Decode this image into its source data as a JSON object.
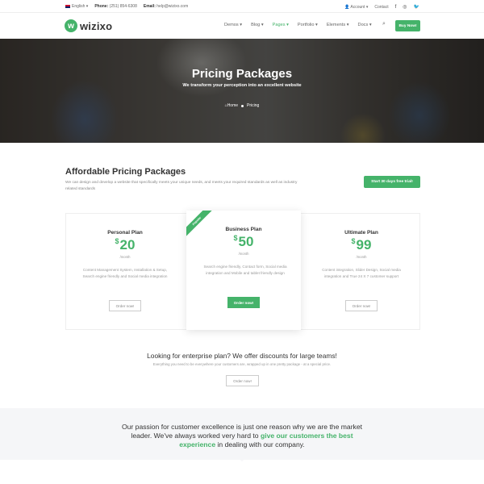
{
  "topbar": {
    "language": "English",
    "phone_label": "Phone:",
    "phone": "(251) 854-6308",
    "email_label": "Email:",
    "email": "help@wizixo.com",
    "account": "Account",
    "contact": "Contact",
    "social_icons": [
      "facebook-icon",
      "instagram-icon",
      "twitter-icon"
    ]
  },
  "header": {
    "logo_mark": "w",
    "logo_text": "wizixo",
    "nav": [
      {
        "label": "Demos"
      },
      {
        "label": "Blog"
      },
      {
        "label": "Pages",
        "active": true
      },
      {
        "label": "Portfolio"
      },
      {
        "label": "Elements"
      },
      {
        "label": "Docs"
      }
    ],
    "buy_label": "Buy Now!",
    "accent": "#45b36a"
  },
  "hero": {
    "title": "Pricing Packages",
    "subtitle": "We transform your perception into an excellent website",
    "breadcrumb": [
      "Home",
      "Pricing"
    ]
  },
  "pricing": {
    "title": "Affordable Pricing Packages",
    "description": "We can design and develop a website that specifically meets your unique needs, and meets your required standards as well as industry related standards",
    "trial_label": "Start 30 days free trial!",
    "plans": [
      {
        "name": "Personal Plan",
        "currency": "$",
        "price": "20",
        "period": "/month",
        "description": "Content Management System, Installation & Setup, Search engine friendly and Social media integration",
        "button": "Order now!"
      },
      {
        "name": "Business Plan",
        "currency": "$",
        "price": "50",
        "period": "/month",
        "description": "Search engine friendly, Contact form, Social media integration and Mobile and tablet friendly design",
        "button": "Order now!",
        "ribbon": "Popular"
      },
      {
        "name": "Ultimate Plan",
        "currency": "$",
        "price": "99",
        "period": "/month",
        "description": "Content integration, Slider Design, Social media integration and True 24 X 7 customer support",
        "button": "Order now!"
      }
    ]
  },
  "enterprise": {
    "title": "Looking for enterprise plan? We offer discounts for large teams!",
    "subtitle": "Everything you need to be everywhere your customers are, wrapped up in one pretty package - at a special price.",
    "button": "Order now!"
  },
  "band": {
    "text_before": "Our passion for customer excellence is just one reason why we are the market leader. We've always worked very hard to ",
    "highlight": "give our customers the best experience",
    "text_after": " in dealing with our company."
  }
}
